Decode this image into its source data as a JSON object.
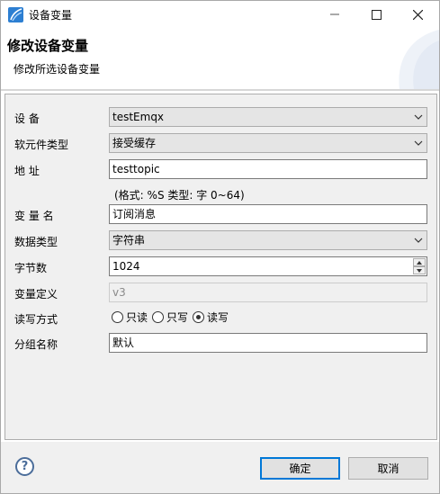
{
  "window": {
    "title": "设备变量"
  },
  "banner": {
    "title": "修改设备变量",
    "subtitle": "修改所选设备变量"
  },
  "form": {
    "device": {
      "label": "设 备",
      "value": "testEmqx"
    },
    "soft_type": {
      "label": "软元件类型",
      "value": "接受缓存"
    },
    "address": {
      "label": "地 址",
      "value": "testtopic",
      "hint": "(格式: %S 类型: 字 0~64)"
    },
    "var_name": {
      "label": "变 量 名",
      "value": "订阅消息"
    },
    "data_type": {
      "label": "数据类型",
      "value": "字符串"
    },
    "byte_count": {
      "label": "字节数",
      "value": "1024"
    },
    "var_def": {
      "label": "变量定义",
      "value": "v3"
    },
    "rw_mode": {
      "label": "读写方式",
      "options": [
        "只读",
        "只写",
        "读写"
      ],
      "selected": "读写"
    },
    "group": {
      "label": "分组名称",
      "value": "默认"
    }
  },
  "footer": {
    "help": "?",
    "ok_label": "确定",
    "cancel_label": "取消"
  },
  "colors": {
    "accent": "#0078d7",
    "help": "#4b6d9a"
  }
}
